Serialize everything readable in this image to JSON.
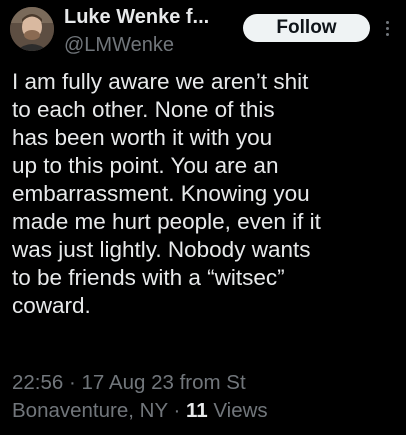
{
  "author": {
    "display_name": "Luke Wenke f...",
    "handle": "@LMWenke"
  },
  "actions": {
    "follow_label": "Follow"
  },
  "tweet": {
    "lines": [
      "I am fully aware we aren’t shit",
      "to each other.  None of this",
      "has been worth it with you",
      "up to this point.  You are an",
      "embarrassment.  Knowing you",
      "made me hurt people, even if it",
      "was just lightly.  Nobody wants",
      "to be friends with a “witsec”",
      "coward."
    ]
  },
  "meta": {
    "time": "22:56",
    "separator": " · ",
    "date": "17 Aug 23",
    "from_prefix": " from St",
    "location_rest": "Bonaventure, NY",
    "views_count": "11",
    "views_label": " Views"
  },
  "icons": {
    "avatar": "avatar",
    "more": "more-icon"
  },
  "colors": {
    "background": "#000000",
    "text": "#e7e9ea",
    "secondary_text": "#71767b",
    "follow_bg": "#eff3f4",
    "follow_text": "#0f1419"
  }
}
